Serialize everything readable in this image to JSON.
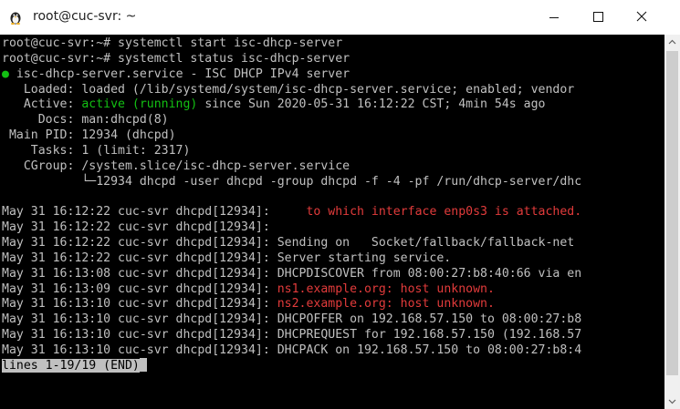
{
  "window": {
    "title": "root@cuc-svr: ~",
    "app_icon": "putty-penguin-icon",
    "controls": {
      "minimize": "minimize-icon",
      "maximize": "maximize-icon",
      "close": "close-icon"
    }
  },
  "colors": {
    "terminal_bg": "#000000",
    "terminal_fg": "#c0c0c0",
    "active_green": "#13c013",
    "error_red": "#e23b3b"
  },
  "terminal": {
    "lines": [
      [
        {
          "t": "root@cuc-svr:~# systemctl start isc-dhcp-server",
          "c": ""
        }
      ],
      [
        {
          "t": "root@cuc-svr:~# systemctl status isc-dhcp-server",
          "c": ""
        }
      ],
      [
        {
          "t": "●",
          "c": "green"
        },
        {
          "t": " isc-dhcp-server.service - ISC DHCP IPv4 server",
          "c": ""
        }
      ],
      [
        {
          "t": "   Loaded: loaded (/lib/systemd/system/isc-dhcp-server.service; enabled; vendor",
          "c": ""
        }
      ],
      [
        {
          "t": "   Active: ",
          "c": ""
        },
        {
          "t": "active (running)",
          "c": "green"
        },
        {
          "t": " since Sun 2020-05-31 16:12:22 CST; 4min 54s ago",
          "c": ""
        }
      ],
      [
        {
          "t": "     Docs: man:dhcpd(8)",
          "c": ""
        }
      ],
      [
        {
          "t": " Main PID: 12934 (dhcpd)",
          "c": ""
        }
      ],
      [
        {
          "t": "    Tasks: 1 (limit: 2317)",
          "c": ""
        }
      ],
      [
        {
          "t": "   CGroup: /system.slice/isc-dhcp-server.service",
          "c": ""
        }
      ],
      [
        {
          "t": "           └─12934 dhcpd -user dhcpd -group dhcpd -f -4 -pf /run/dhcp-server/dhc",
          "c": ""
        }
      ],
      [
        {
          "t": "",
          "c": ""
        }
      ],
      [
        {
          "t": "May 31 16:12:22 cuc-svr dhcpd[12934]:    ",
          "c": ""
        },
        {
          "t": " to which interface enp0s3 is attached.",
          "c": "red"
        }
      ],
      [
        {
          "t": "May 31 16:12:22 cuc-svr dhcpd[12934]:",
          "c": ""
        }
      ],
      [
        {
          "t": "May 31 16:12:22 cuc-svr dhcpd[12934]: Sending on   Socket/fallback/fallback-net",
          "c": ""
        }
      ],
      [
        {
          "t": "May 31 16:12:22 cuc-svr dhcpd[12934]: Server starting service.",
          "c": ""
        }
      ],
      [
        {
          "t": "May 31 16:13:08 cuc-svr dhcpd[12934]: DHCPDISCOVER from 08:00:27:b8:40:66 via en",
          "c": ""
        }
      ],
      [
        {
          "t": "May 31 16:13:09 cuc-svr dhcpd[12934]: ",
          "c": ""
        },
        {
          "t": "ns1.example.org: host unknown.",
          "c": "red"
        }
      ],
      [
        {
          "t": "May 31 16:13:10 cuc-svr dhcpd[12934]: ",
          "c": ""
        },
        {
          "t": "ns2.example.org: host unknown.",
          "c": "red"
        }
      ],
      [
        {
          "t": "May 31 16:13:10 cuc-svr dhcpd[12934]: DHCPOFFER on 192.168.57.150 to 08:00:27:b8",
          "c": ""
        }
      ],
      [
        {
          "t": "May 31 16:13:10 cuc-svr dhcpd[12934]: DHCPREQUEST for 192.168.57.150 (192.168.57",
          "c": ""
        }
      ],
      [
        {
          "t": "May 31 16:13:10 cuc-svr dhcpd[12934]: DHCPACK on 192.168.57.150 to 08:00:27:b8:4",
          "c": ""
        }
      ]
    ],
    "pager_status": "lines 1-19/19 (END)"
  }
}
